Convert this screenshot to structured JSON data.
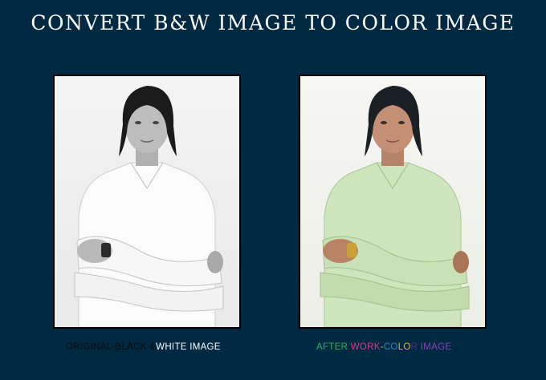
{
  "title": "CONVERT B&W IMAGE TO COLOR IMAGE",
  "panels": {
    "original": {
      "image_subject": "man-with-crossed-arms-bw"
    },
    "after": {
      "image_subject": "man-with-crossed-arms-colorized"
    }
  },
  "captions": {
    "left": {
      "part1": "ORIGINAL-BLACK &",
      "part2": "WHITE IMAGE",
      "colors": {
        "part1": "#0a0a0a",
        "part2": "#ffffff"
      }
    },
    "right": {
      "part1": "AFTER ",
      "part2": "WORK",
      "part3": "-",
      "part4": "CO",
      "part5": "LO",
      "part6": "R",
      "part7": " IMAGE",
      "colors": {
        "part1": "#2fae5a",
        "part2": "#e0338a",
        "part3": "#9bd23a",
        "part4": "#1e88d6",
        "part5": "#f0b21a",
        "part6": "#4a2a8a",
        "part7": "#8b3fb8"
      }
    }
  },
  "colors": {
    "background": "#012a42",
    "title": "#ffffff",
    "frame": "#000000"
  }
}
